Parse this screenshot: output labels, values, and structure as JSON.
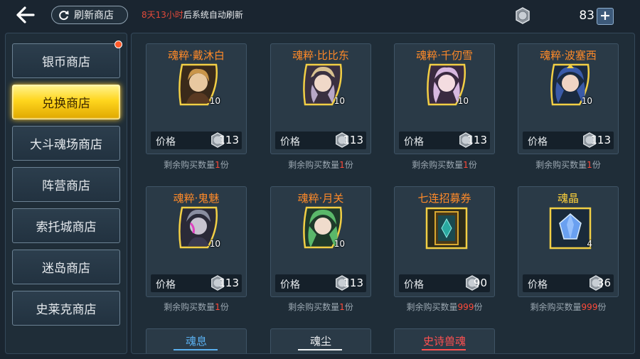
{
  "header": {
    "refresh_button_label": "刷新商店",
    "refresh_time_highlight": "8天13小时",
    "refresh_time_rest": "后系统自动刷新",
    "currency_amount": "83",
    "plus_label": "+"
  },
  "sidebar": {
    "items": [
      {
        "label": "银币商店",
        "active": false,
        "has_dot": true
      },
      {
        "label": "兑换商店",
        "active": true,
        "has_dot": false
      },
      {
        "label": "大斗魂场商店",
        "active": false,
        "has_dot": false
      },
      {
        "label": "阵营商店",
        "active": false,
        "has_dot": false
      },
      {
        "label": "索托城商店",
        "active": false,
        "has_dot": false
      },
      {
        "label": "迷岛商店",
        "active": false,
        "has_dot": false
      },
      {
        "label": "史莱克商店",
        "active": false,
        "has_dot": false
      }
    ]
  },
  "price_label": "价格",
  "remain_prefix": "剩余购买数量",
  "remain_suffix": "份",
  "items": [
    {
      "name": "魂粹·戴沐白",
      "count": "10",
      "price": "113",
      "remain": "1",
      "icon": "hero-portrait-daimubai-icon",
      "color": "#c9954a"
    },
    {
      "name": "魂粹·比比东",
      "count": "10",
      "price": "113",
      "remain": "1",
      "icon": "hero-portrait-bibidong-icon",
      "color": "#b8a8c8"
    },
    {
      "name": "魂粹·千仞雪",
      "count": "10",
      "price": "113",
      "remain": "1",
      "icon": "hero-portrait-qianrenxue-icon",
      "color": "#d8b8e0"
    },
    {
      "name": "魂粹·波塞西",
      "count": "10",
      "price": "113",
      "remain": "1",
      "icon": "hero-portrait-bosaixi-icon",
      "color": "#3a5aa8"
    },
    {
      "name": "魂粹·鬼魅",
      "count": "10",
      "price": "113",
      "remain": "1",
      "icon": "hero-portrait-guimei-icon",
      "color": "#8a8ea0"
    },
    {
      "name": "魂粹·月关",
      "count": "10",
      "price": "113",
      "remain": "1",
      "icon": "hero-portrait-yueguan-icon",
      "color": "#5ab86a"
    },
    {
      "name": "七连招募券",
      "count": "",
      "price": "90",
      "remain": "999",
      "icon": "recruit-ticket-icon",
      "color": "#2aa8a0"
    },
    {
      "name": "魂晶",
      "count": "4",
      "price": "36",
      "remain": "999",
      "icon": "soul-crystal-icon",
      "color": "#6aa0f0"
    }
  ],
  "partial_items": [
    {
      "name": "魂息",
      "color": "#5ab0f0"
    },
    {
      "name": "魂尘",
      "color": "#f0f2f4"
    },
    {
      "name": "史诗兽魂",
      "color": "#ff5050"
    }
  ]
}
